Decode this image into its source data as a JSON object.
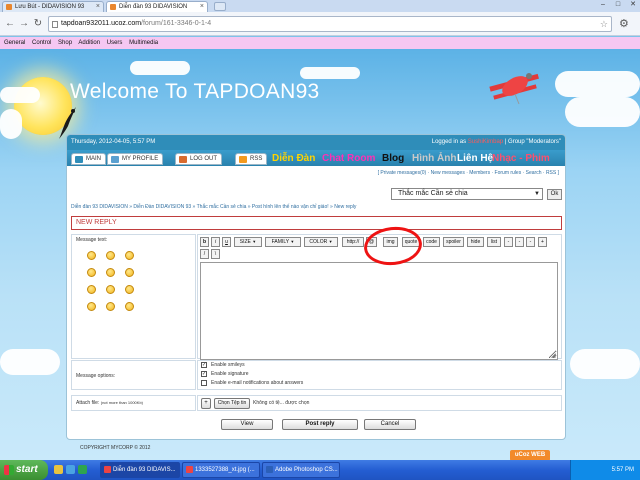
{
  "browser": {
    "tabs": [
      {
        "label": "Lưu Bút - DIDAVISION 93",
        "active": false
      },
      {
        "label": "Diễn đàn 93 DIDAVISION",
        "active": true
      }
    ],
    "url_host": "tapdoan932011.ucoz.com",
    "url_path": "/forum/161-3346-0-1-4",
    "bookmarks": [
      "General",
      "Control",
      "Shop",
      "Addition",
      "Users",
      "Multimedia"
    ]
  },
  "site": {
    "title": "Welcome To TAPDOAN93"
  },
  "topbar": {
    "datetime": "Thursday, 2012-04-05, 5:57 PM",
    "logged_in_prefix": "Logged in as",
    "username": "SushiKimbap",
    "group_text": "| Group \"Moderators\""
  },
  "menu": {
    "tabs": [
      "MAIN",
      "MY PROFILE",
      "LOG OUT",
      "RSS"
    ],
    "links": [
      {
        "label": "Diễn Đàn",
        "color": "#ffd400"
      },
      {
        "label": "Chat Room",
        "color": "#ff2fb5"
      },
      {
        "label": "Blog",
        "color": "#111111"
      },
      {
        "label": "Hình Ảnh",
        "color": "#c9c9c9"
      },
      {
        "label": "Liên Hệ",
        "color": "#ffffff"
      },
      {
        "label": "Nhạc - Phim",
        "color": "#ff4f6d"
      }
    ]
  },
  "infobar": "[ Private messages(0) · New messages · Members · Forum rules · Search · RSS ]",
  "forum_select": "Thắc mắc Cần sẻ chia",
  "ok_label": "Ok",
  "breadcrumb": "Diễn đàn 93 DIDAVISION » Diễn Đàn DIDAVISION 93 » Thắc mắc Cần sẻ chia » Post hình lên thế nào vận chỉ giáo! » New reply",
  "form": {
    "heading": "NEW REPLY",
    "message_label": "Message text:",
    "toolbar_row1": [
      "b",
      "i",
      "u",
      "SIZE",
      "FAMILY",
      "COLOR",
      "http://",
      "@",
      "img",
      "quote",
      "code",
      "spoiler",
      "hide",
      "list",
      "-",
      "-",
      "-",
      "+"
    ],
    "toolbar_row2": [
      "/",
      "\\"
    ],
    "options_label": "Message options:",
    "options": [
      "Enable smileys",
      "Enable signature",
      "Enable e-mail notifications about answers"
    ],
    "attach_label": "Attach file:",
    "attach_hint": "(not more than 1000Kb)",
    "attach_plus": "+",
    "choose_file": "Chọn Tệp tin",
    "no_file": "Không có tệ... được chọn",
    "buttons": [
      "View",
      "Post reply",
      "Cancel"
    ]
  },
  "footer": {
    "copyright": "COPYRIGHT MYCORP © 2012",
    "ucoz": "uCoz WEB"
  },
  "taskbar": {
    "start": "start",
    "tasks": [
      "Diễn đàn 93 DIDAVIS...",
      "1333527388_xt.jpg (...",
      "Adobe Photoshop CS..."
    ],
    "clock": "5:57 PM"
  }
}
